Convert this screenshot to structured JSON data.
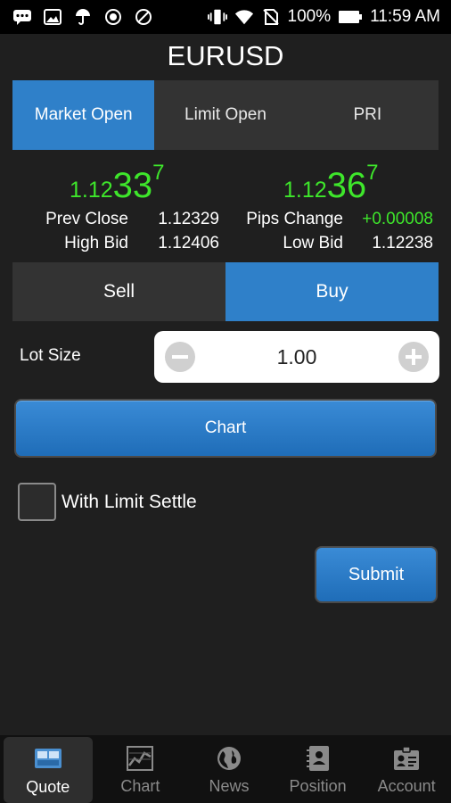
{
  "status_bar": {
    "battery": "100%",
    "time": "11:59 AM",
    "left_icons": [
      "message-icon",
      "image-icon",
      "umbrella-icon",
      "radio-icon",
      "blocked-icon"
    ],
    "right_icons": [
      "vibrate-icon",
      "wifi-icon",
      "no-sim-icon",
      "battery-icon"
    ]
  },
  "title": "EURUSD",
  "tabs": [
    {
      "label": "Market Open",
      "active": true
    },
    {
      "label": "Limit Open",
      "active": false
    },
    {
      "label": "PRI",
      "active": false
    }
  ],
  "quotes": {
    "sell": {
      "small": "1.12",
      "big": "33",
      "sup": "7"
    },
    "buy": {
      "small": "1.12",
      "big": "36",
      "sup": "7"
    }
  },
  "stats": {
    "prev_close_label": "Prev Close",
    "prev_close_value": "1.12329",
    "pips_change_label": "Pips Change",
    "pips_change_value": "+0.00008",
    "high_bid_label": "High Bid",
    "high_bid_value": "1.12406",
    "low_bid_label": "Low Bid",
    "low_bid_value": "1.12238"
  },
  "side": {
    "sell_label": "Sell",
    "buy_label": "Buy",
    "selected": "Buy"
  },
  "lot": {
    "label": "Lot Size",
    "value": "1.00"
  },
  "chart_button": "Chart",
  "limit_settle": {
    "label": "With Limit Settle",
    "checked": false
  },
  "submit_button": "Submit",
  "colors": {
    "accent": "#2f80c9",
    "price_green": "#3ee62b",
    "background": "#1f1f1f"
  },
  "bottom_nav": [
    {
      "label": "Quote",
      "icon": "quote-icon",
      "active": true
    },
    {
      "label": "Chart",
      "icon": "chart-icon",
      "active": false
    },
    {
      "label": "News",
      "icon": "globe-icon",
      "active": false
    },
    {
      "label": "Position",
      "icon": "notebook-icon",
      "active": false
    },
    {
      "label": "Account",
      "icon": "id-badge-icon",
      "active": false
    }
  ]
}
